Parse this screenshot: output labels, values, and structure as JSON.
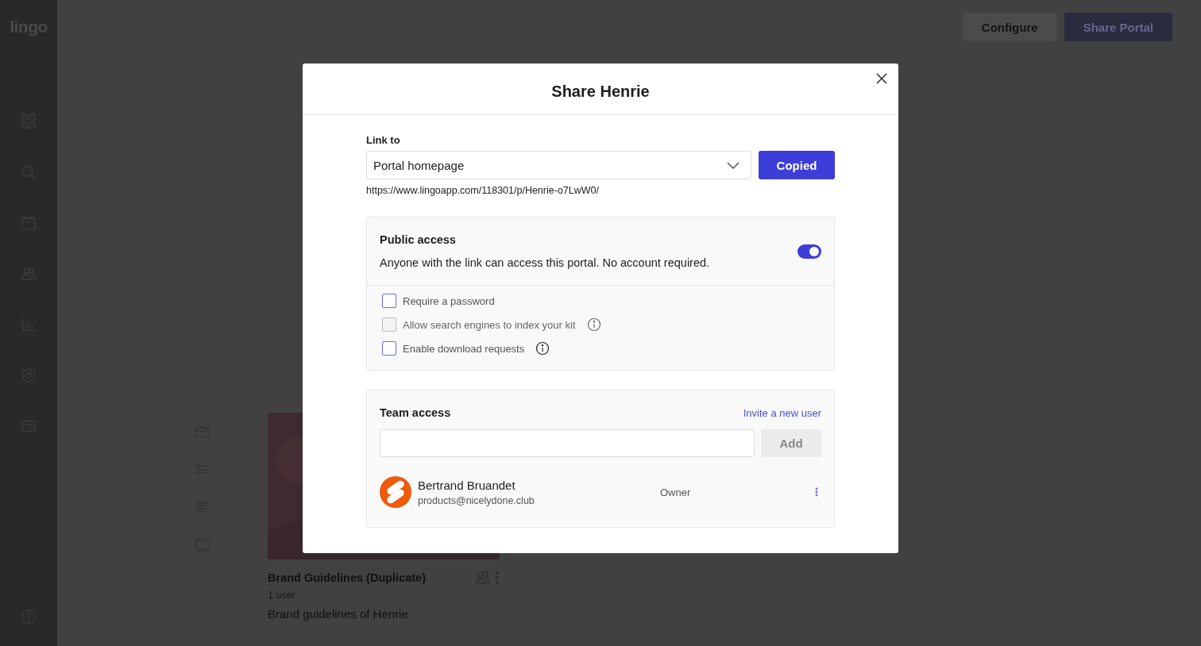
{
  "sidebar": {
    "logo": "lingo"
  },
  "header_buttons": [
    {
      "label": "Configure",
      "kind": "secondary"
    },
    {
      "label": "Share Portal",
      "kind": "primary"
    }
  ],
  "kit_card": {
    "title": "Brand Guidelines (Duplicate)",
    "meta": "1 user",
    "description": "Brand guidelines of Henrie"
  },
  "dialog": {
    "title": "Share Henrie",
    "link_to": {
      "label": "Link to",
      "value": "Portal homepage"
    },
    "copy_button": "Copied",
    "url": "https://www.lingoapp.com/118301/p/Henrie-o7LwW0/",
    "public_access": {
      "title": "Public access",
      "description": "Anyone with the link can access this portal. No account required.",
      "on": true,
      "options": [
        {
          "label": "Require a password",
          "checked": false,
          "disabled": false,
          "info": false
        },
        {
          "label": "Allow search engines to index your kit",
          "checked": false,
          "disabled": true,
          "info": true
        },
        {
          "label": "Enable download requests",
          "checked": false,
          "disabled": false,
          "info": true
        }
      ]
    },
    "team_access": {
      "title": "Team access",
      "invite_link": "Invite a new user",
      "add_button": "Add",
      "members": [
        {
          "name": "Bertrand Bruandet",
          "email": "products@nicelydone.club",
          "role": "Owner"
        }
      ]
    }
  }
}
